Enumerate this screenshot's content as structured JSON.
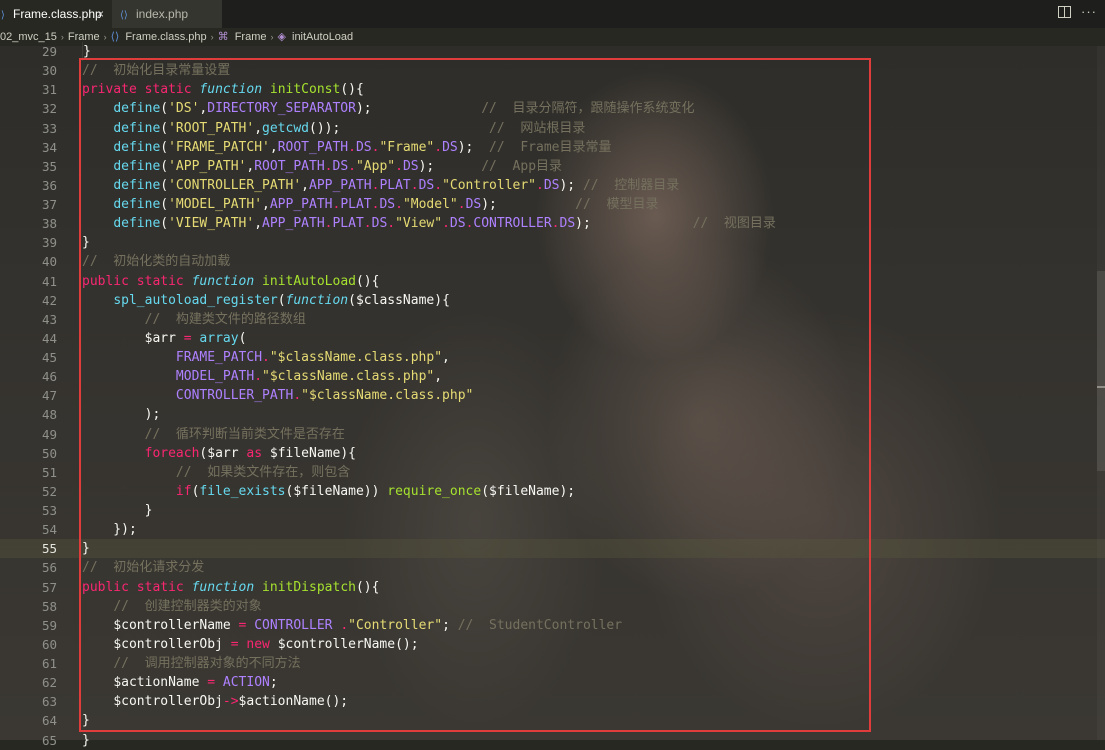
{
  "tabs": [
    {
      "label": "Frame.class.php",
      "active": true,
      "close": "×"
    },
    {
      "label": "index.php",
      "active": false
    }
  ],
  "breadcrumb": [
    "02_mvc_15",
    "Frame",
    "Frame.class.php",
    "Frame",
    "initAutoLoad"
  ],
  "editor": {
    "highlighted_lines": [
      30,
      64
    ],
    "current_line": 55,
    "lines": [
      {
        "n": "29",
        "html": "<span class='g'></span>}"
      },
      {
        "n": "30",
        "html": "<span class='cm2'>//  初始化目录常量设置</span>"
      },
      {
        "n": "31",
        "html": "<span class='kw'>private</span> <span class='kw'>static</span> <span class='it'>function</span> <span class='fn'>initConst</span>(){"
      },
      {
        "n": "32",
        "html": "    <span class='bi'>define</span>(<span class='st'>'DS'</span>,<span class='cn'>DIRECTORY_SEPARATOR</span>);              <span class='cm2'>//  目录分隔符，跟随操作系统变化</span>"
      },
      {
        "n": "33",
        "html": "    <span class='bi'>define</span>(<span class='st'>'ROOT_PATH'</span>,<span class='bi'>getcwd</span>());                   <span class='cm2'>//  网站根目录</span>"
      },
      {
        "n": "34",
        "html": "    <span class='bi'>define</span>(<span class='st'>'FRAME_PATCH'</span>,<span class='cn'>ROOT_PATH</span><span class='op'>.</span><span class='cn'>DS</span><span class='op'>.</span><span class='st'>\"Frame\"</span><span class='op'>.</span><span class='cn'>DS</span>);  <span class='cm2'>//  Frame目录常量</span>"
      },
      {
        "n": "35",
        "html": "    <span class='bi'>define</span>(<span class='st'>'APP_PATH'</span>,<span class='cn'>ROOT_PATH</span><span class='op'>.</span><span class='cn'>DS</span><span class='op'>.</span><span class='st'>\"App\"</span><span class='op'>.</span><span class='cn'>DS</span>);      <span class='cm2'>//  App目录</span>"
      },
      {
        "n": "36",
        "html": "    <span class='bi'>define</span>(<span class='st'>'CONTROLLER_PATH'</span>,<span class='cn'>APP_PATH</span><span class='op'>.</span><span class='cn'>PLAT</span><span class='op'>.</span><span class='cn'>DS</span><span class='op'>.</span><span class='st'>\"Controller\"</span><span class='op'>.</span><span class='cn'>DS</span>); <span class='cm2'>//  控制器目录</span>"
      },
      {
        "n": "37",
        "html": "    <span class='bi'>define</span>(<span class='st'>'MODEL_PATH'</span>,<span class='cn'>APP_PATH</span><span class='op'>.</span><span class='cn'>PLAT</span><span class='op'>.</span><span class='cn'>DS</span><span class='op'>.</span><span class='st'>\"Model\"</span><span class='op'>.</span><span class='cn'>DS</span>);          <span class='cm2'>//  模型目录</span>"
      },
      {
        "n": "38",
        "html": "    <span class='bi'>define</span>(<span class='st'>'VIEW_PATH'</span>,<span class='cn'>APP_PATH</span><span class='op'>.</span><span class='cn'>PLAT</span><span class='op'>.</span><span class='cn'>DS</span><span class='op'>.</span><span class='st'>\"View\"</span><span class='op'>.</span><span class='cn'>DS</span><span class='op'>.</span><span class='cn'>CONTROLLER</span><span class='op'>.</span><span class='cn'>DS</span>);             <span class='cm2'>//  视图目录</span>"
      },
      {
        "n": "39",
        "html": "}"
      },
      {
        "n": "40",
        "html": "<span class='cm2'>//  初始化类的自动加载</span>"
      },
      {
        "n": "41",
        "html": "<span class='kw'>public</span> <span class='kw'>static</span> <span class='it'>function</span> <span class='fn'>initAutoLoad</span>(){"
      },
      {
        "n": "42",
        "html": "    <span class='bi'>spl_autoload_register</span>(<span class='it'>function</span>(<span class='vr'>$className</span>){"
      },
      {
        "n": "43",
        "html": "        <span class='cm2'>//  构建类文件的路径数组</span>"
      },
      {
        "n": "44",
        "html": "        <span class='vr'>$arr</span> <span class='op'>=</span> <span class='bi'>array</span>("
      },
      {
        "n": "45",
        "html": "            <span class='cn'>FRAME_PATCH</span><span class='op'>.</span><span class='st'>\"$className.class.php\"</span>,"
      },
      {
        "n": "46",
        "html": "            <span class='cn'>MODEL_PATH</span><span class='op'>.</span><span class='st'>\"$className.class.php\"</span>,"
      },
      {
        "n": "47",
        "html": "            <span class='cn'>CONTROLLER_PATH</span><span class='op'>.</span><span class='st'>\"$className.class.php\"</span>"
      },
      {
        "n": "48",
        "html": "        );"
      },
      {
        "n": "49",
        "html": "        <span class='cm2'>//  循环判断当前类文件是否存在</span>"
      },
      {
        "n": "50",
        "html": "        <span class='kw'>foreach</span>(<span class='vr'>$arr</span> <span class='kw'>as</span> <span class='vr'>$fileName</span>){"
      },
      {
        "n": "51",
        "html": "            <span class='cm2'>//  如果类文件存在，则包含</span>"
      },
      {
        "n": "52",
        "html": "            <span class='kw'>if</span>(<span class='bi'>file_exists</span>(<span class='vr'>$fileName</span>)) <span class='fn'>require_once</span>(<span class='vr'>$fileName</span>);"
      },
      {
        "n": "53",
        "html": "        }"
      },
      {
        "n": "54",
        "html": "    });"
      },
      {
        "n": "55",
        "html": "}"
      },
      {
        "n": "56",
        "html": "<span class='cm2'>//  初始化请求分发</span>"
      },
      {
        "n": "57",
        "html": "<span class='kw'>public</span> <span class='kw'>static</span> <span class='it'>function</span> <span class='fn'>initDispatch</span>(){"
      },
      {
        "n": "58",
        "html": "    <span class='cm2'>//  创建控制器类的对象</span>"
      },
      {
        "n": "59",
        "html": "    <span class='vr'>$controllerName</span> <span class='op'>=</span> <span class='cn'>CONTROLLER</span> <span class='op'>.</span><span class='st'>\"Controller\"</span>; <span class='cm2'>//  StudentController</span>"
      },
      {
        "n": "60",
        "html": "    <span class='vr'>$controllerObj</span> <span class='op'>=</span> <span class='kw'>new</span> <span class='vr'>$controllerName</span>();"
      },
      {
        "n": "61",
        "html": "    <span class='cm2'>//  调用控制器对象的不同方法</span>"
      },
      {
        "n": "62",
        "html": "    <span class='vr'>$actionName</span> <span class='op'>=</span> <span class='cn'>ACTION</span>;"
      },
      {
        "n": "63",
        "html": "    <span class='vr'>$controllerObj</span><span class='op'>-&gt;</span><span class='vr'>$actionName</span>();"
      },
      {
        "n": "64",
        "html": "}"
      },
      {
        "n": "65",
        "html": "}"
      }
    ]
  },
  "colors": {
    "keyword": "#f92672",
    "function_name": "#a6e22e",
    "string": "#e6db74",
    "constant": "#ae81ff",
    "builtin": "#66d9ef",
    "comment": "#75715e",
    "highlight_box": "#e03c3c"
  },
  "icons": {
    "file_icon": "php-file-icon",
    "split": "split-editor-icon",
    "more": "more-actions-icon",
    "symbol": "method-symbol-icon"
  }
}
